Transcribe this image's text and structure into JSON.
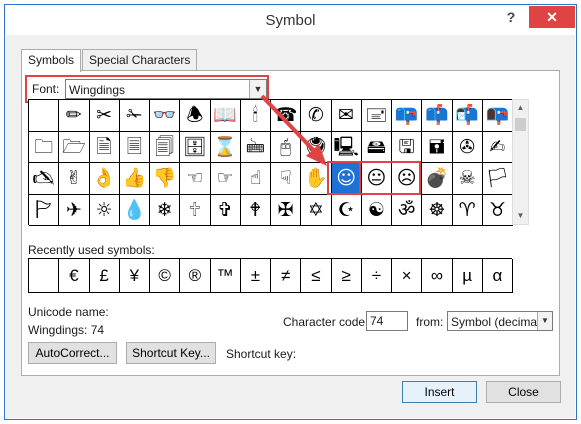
{
  "window": {
    "title": "Symbol",
    "help_label": "?",
    "close_label": "✕"
  },
  "tabs": [
    {
      "label": "Symbols",
      "active": true
    },
    {
      "label": "Special Characters",
      "active": false
    }
  ],
  "font": {
    "label": "Font:",
    "value": "Wingdings"
  },
  "symbol_grid": {
    "rows": [
      [
        "",
        "✏",
        "✂",
        "✁",
        "👓",
        "🕭",
        "📖",
        "🕯",
        "☎",
        "✆",
        "✉",
        "🖃",
        "📪",
        "📫",
        "📬",
        "📭"
      ],
      [
        "🗀",
        "🗁",
        "🗎",
        "🗏",
        "🗐",
        "🗄",
        "⌛",
        "🖮",
        "🖰",
        "🖲",
        "🖳",
        "🖴",
        "🖫",
        "🖬",
        "✇",
        "✍"
      ],
      [
        "🖎",
        "✌",
        "👌",
        "👍",
        "👎",
        "☜",
        "☞",
        "☝",
        "☟",
        "✋",
        "☺",
        "😐",
        "☹",
        "💣",
        "☠",
        "🏳"
      ],
      [
        "🏱",
        "✈",
        "☼",
        "💧",
        "❄",
        "🕆",
        "✞",
        "🕈",
        "✠",
        "✡",
        "☪",
        "☯",
        "ॐ",
        "☸",
        "♈",
        "♉"
      ]
    ],
    "selected": {
      "row": 2,
      "col": 10
    }
  },
  "scroll": {
    "up_icon": "▲",
    "down_icon": "▼"
  },
  "recent": {
    "label": "Recently used symbols:",
    "symbols": [
      "",
      "€",
      "£",
      "¥",
      "©",
      "®",
      "™",
      "±",
      "≠",
      "≤",
      "≥",
      "÷",
      "×",
      "∞",
      "µ",
      "α"
    ]
  },
  "unicode": {
    "name_label": "Unicode name:",
    "value": "Wingdings: 74"
  },
  "character_code": {
    "label": "Character code:",
    "value": "74"
  },
  "from": {
    "label": "from:",
    "value": "Symbol (decimal)"
  },
  "buttons": {
    "autocorrect": "AutoCorrect...",
    "shortcut_key": "Shortcut Key...",
    "insert": "Insert",
    "close": "Close"
  },
  "shortcut_key_label": "Shortcut key:",
  "colors": {
    "highlight": "#e04343",
    "selection": "#1e72d6",
    "titlebar_border": "#2b78c5"
  }
}
